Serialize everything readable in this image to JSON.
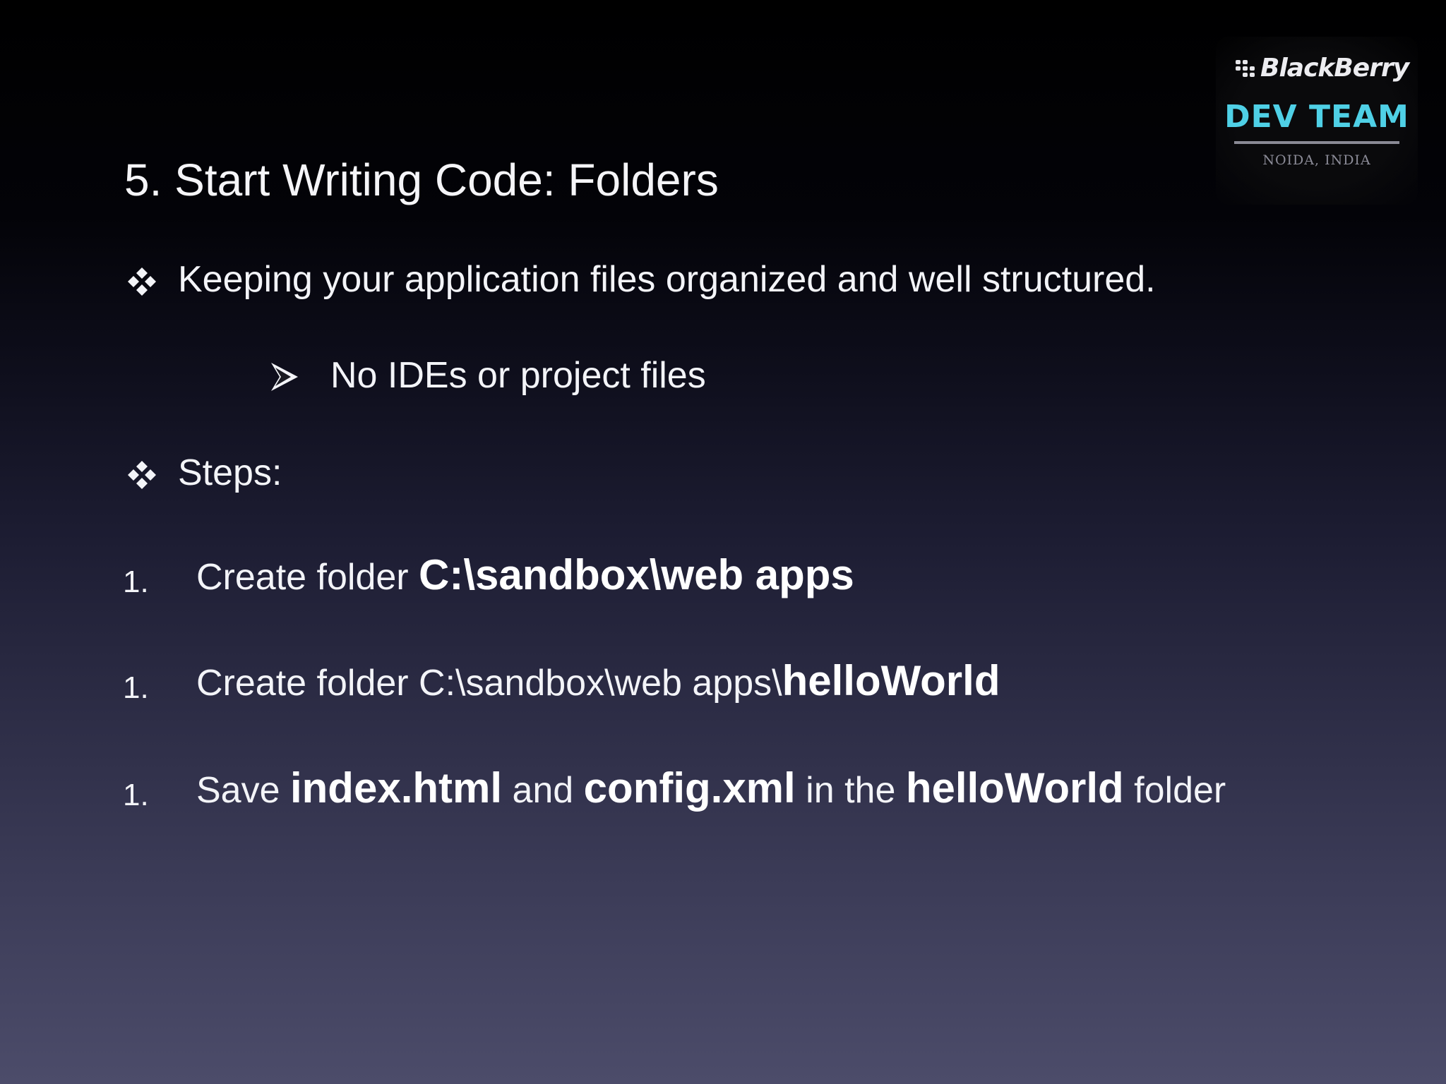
{
  "slide": {
    "title": "5. Start Writing Code: Folders",
    "bullet1": "Keeping your application files organized and well structured.",
    "subbullet1": "No IDEs or project files",
    "bullet2": "Steps:",
    "steps": [
      {
        "number": "1.",
        "parts": [
          {
            "text": "Create folder ",
            "bold": false
          },
          {
            "text": "C:\\sandbox\\web apps",
            "bold": true
          }
        ]
      },
      {
        "number": "1.",
        "parts": [
          {
            "text": "Create folder C:\\sandbox\\web apps\\",
            "bold": false
          },
          {
            "text": "helloWorld",
            "bold": true
          }
        ]
      },
      {
        "number": "1.",
        "parts": [
          {
            "text": "Save ",
            "bold": false
          },
          {
            "text": "index.html",
            "bold": true
          },
          {
            "text": " and ",
            "bold": false
          },
          {
            "text": "config.xml",
            "bold": true
          },
          {
            "text": " in the ",
            "bold": false
          },
          {
            "text": "helloWorld",
            "bold": true
          },
          {
            "text": " folder",
            "bold": false
          }
        ]
      }
    ]
  },
  "logo": {
    "brand": "BlackBerry",
    "team": "DEV TEAM",
    "location": "NOIDA, INDIA"
  },
  "colors": {
    "text": "#f3f4f8",
    "logo_team": "#4fd0e6"
  },
  "icons": {
    "diamond_bullet": "four-diamond-bullet-icon",
    "arrow_bullet": "arrowhead-bullet-icon"
  }
}
